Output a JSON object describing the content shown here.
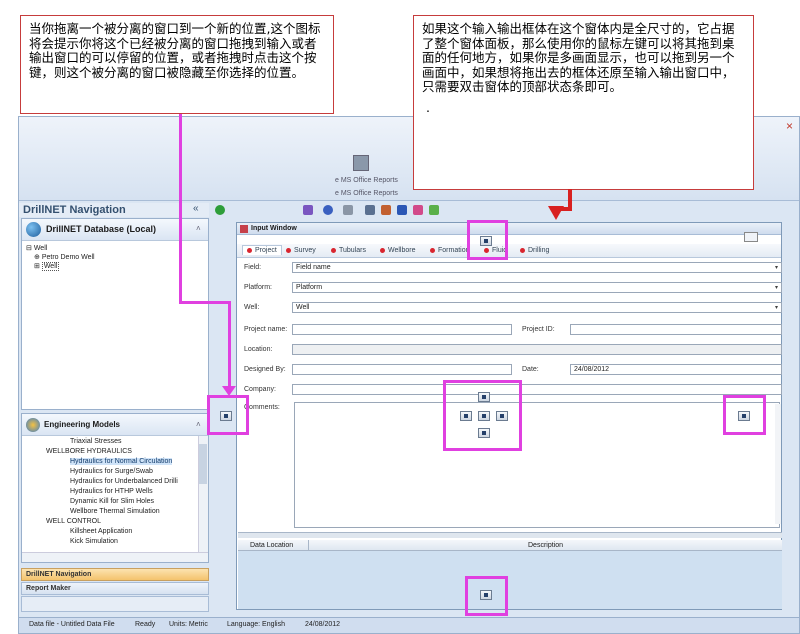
{
  "callouts": {
    "left": "当你拖离一个被分离的窗口到一个新的位置,这个图标将会提示你将这个已经被分离的窗口拖拽到输入或者输出窗口的可以停留的位置，或者拖拽时点击这个按键，则这个被分离的窗口被隐藏至你选择的位置。",
    "right": "如果这个输入输出框体在这个窗体内是全尺寸的，它占据了整个窗体面板，那么使用你的鼠标左键可以将其拖到桌面的任何地方，如果你是多画面显示，也可以拖到另一个画面中，如果想将拖出去的框体还原至输入输出窗口中，只需要双击窗体的顶部状态条即可。",
    "right_dot": "."
  },
  "app": {
    "close_glyph": "×",
    "ribbon": {
      "reports_label_1": "e MS Office Reports",
      "reports_label_2": "e MS Office Reports"
    },
    "nav_header": "DrillNET Navigation",
    "nav_collapse": "«"
  },
  "db_panel": {
    "title": "DrillNET Database (Local)",
    "chevron": "˄",
    "tree": [
      "Well",
      "Petro Demo Well",
      "Well"
    ],
    "tree_prefix": [
      "⊟",
      "⊕",
      "⊞"
    ]
  },
  "eng_panel": {
    "title": "Engineering Models",
    "chevron": "˄",
    "items": [
      "Triaxial Stresses",
      "WELLBORE HYDRAULICS",
      "Hydraulics for Normal Circulation",
      "Hydraulics for Surge/Swab",
      "Hydraulics for Underbalanced Drilli",
      "Hydraulics for HTHP Wells",
      "Dynamic Kill for Slim Holes",
      "Wellbore Thermal Simulation",
      "WELL CONTROL",
      "Killsheet Application",
      "Kick Simulation"
    ],
    "selected_index": 2
  },
  "nav_strips": {
    "drillnet_navigation": "DrillNET Navigation",
    "report_maker": "Report Maker"
  },
  "status_bar": {
    "data_file": "Data file - Untitled Data File",
    "ready": "Ready",
    "units": "Units: Metric",
    "language": "Language: English",
    "date": "24/08/2012"
  },
  "input_window": {
    "title": "Input Window",
    "tabs": [
      "Project",
      "Survey",
      "Tubulars",
      "Wellbore",
      "Formation",
      "Fluid",
      "Drilling"
    ],
    "active_tab": "Project",
    "fields": {
      "field_label": "Field:",
      "field_value": "Field name",
      "platform_label": "Platform:",
      "platform_value": "Platform",
      "well_label": "Well:",
      "well_value": "Well",
      "project_name_label": "Project name:",
      "project_name_value": "",
      "project_id_label": "Project ID:",
      "project_id_value": "",
      "location_label": "Location:",
      "location_value": "",
      "designed_by_label": "Designed By:",
      "designed_by_value": "",
      "date_label": "Date:",
      "date_value": "24/08/2012",
      "company_label": "Company:",
      "company_value": "",
      "comments_label": "Comments:"
    },
    "dropdown_glyph": "▾",
    "grid_headers": [
      "Data Location",
      "Description"
    ]
  },
  "colors": {
    "highlight": "#e040e0",
    "callout_border": "#c63c3c",
    "arrow": "#d82020"
  }
}
